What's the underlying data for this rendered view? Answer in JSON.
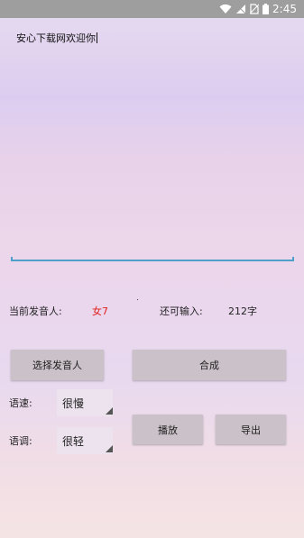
{
  "status_bar": {
    "time": "2:45",
    "icons": [
      "wifi-icon",
      "signal-icon",
      "no-sim-icon",
      "battery-icon"
    ]
  },
  "editor": {
    "text": "安心下载网欢迎你"
  },
  "info": {
    "speaker_label": "当前发音人:",
    "speaker_value": "女7",
    "remaining_label": "还可输入:",
    "remaining_value": "212字"
  },
  "buttons": {
    "select_speaker": "选择发音人",
    "synthesize": "合成",
    "play": "播放",
    "export": "导出"
  },
  "controls": {
    "speed_label": "语速:",
    "speed_value": "很慢",
    "tone_label": "语调:",
    "tone_value": "很轻"
  },
  "colors": {
    "speaker_value": "#e0201a",
    "underline": "#4fa0c9",
    "button": "#cbc2c9",
    "status_bar": "#9e9e9e"
  }
}
